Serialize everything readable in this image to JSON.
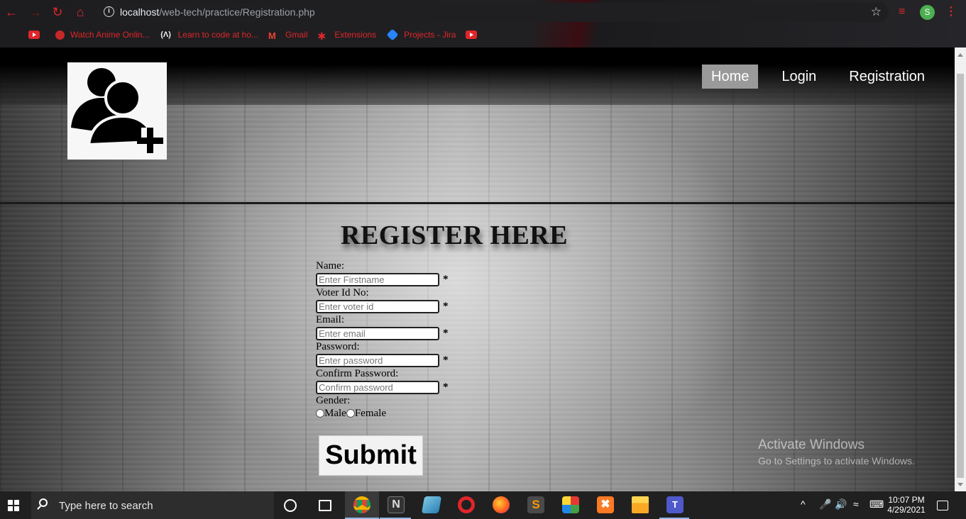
{
  "browser": {
    "url_host": "localhost",
    "url_path": "/web-tech/practice/Registration.php",
    "profile_initial": "S",
    "bookmarks": [
      {
        "label": "",
        "icon": "youtube-icon"
      },
      {
        "label": "Watch Anime Onlin...",
        "icon": "anime-site-icon"
      },
      {
        "label": "Learn to code at ho...",
        "icon": "freecodecamp-icon"
      },
      {
        "label": "Gmail",
        "icon": "gmail-icon"
      },
      {
        "label": "Extensions",
        "icon": "puzzle-icon"
      },
      {
        "label": "Projects - Jira",
        "icon": "jira-icon"
      },
      {
        "label": "",
        "icon": "youtube-icon"
      }
    ]
  },
  "page": {
    "nav": [
      {
        "label": "Home",
        "active": true
      },
      {
        "label": "Login",
        "active": false
      },
      {
        "label": "Registration",
        "active": false
      }
    ],
    "title": "REGISTER HERE",
    "form": {
      "name_label": "Name:",
      "name_placeholder": "Enter Firstname",
      "voter_label": "Voter Id No:",
      "voter_placeholder": "Enter voter id",
      "email_label": "Email:",
      "email_placeholder": "Enter email",
      "password_label": "Password:",
      "password_placeholder": "Enter password",
      "confirm_label": "Confirm Password:",
      "confirm_placeholder": "Confirm password",
      "required_mark": "*",
      "gender_label": "Gender:",
      "male_label": "Male",
      "female_label": "Female",
      "submit_label": "Submit"
    }
  },
  "watermark": {
    "line1": "Activate Windows",
    "line2": "Go to Settings to activate Windows."
  },
  "taskbar": {
    "search_placeholder": "Type here to search",
    "time": "10:07 PM",
    "date": "4/29/2021"
  }
}
